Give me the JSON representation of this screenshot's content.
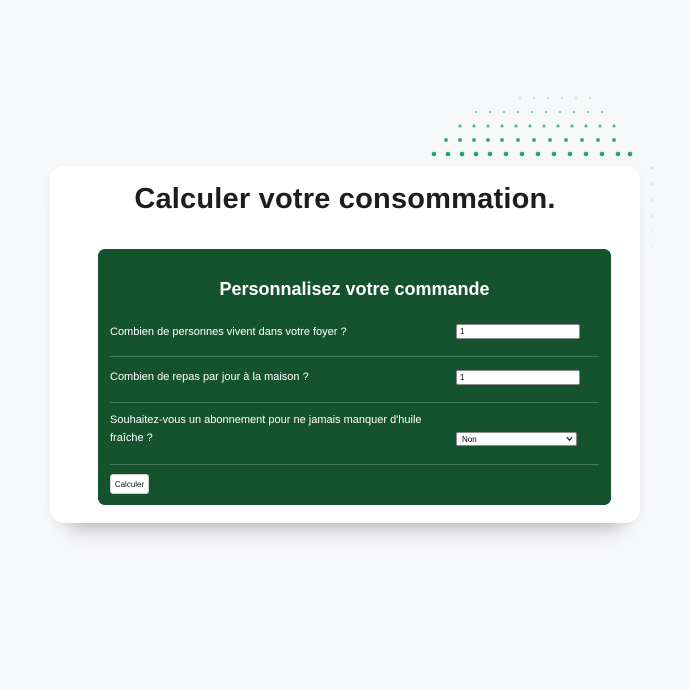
{
  "title": "Calculer votre consommation.",
  "form": {
    "heading": "Personnalisez votre commande",
    "q1_label": "Combien de personnes vivent dans votre foyer ?",
    "q1_value": "1",
    "q2_label": "Combien de repas par jour à la maison ?",
    "q2_value": "1",
    "q3_label": "Souhaitez-vous un abonnement pour ne jamais manquer d'huile fraîche ?",
    "q3_selected": "Non",
    "submit_label": "Calculer"
  },
  "colors": {
    "panel": "#14532d",
    "dots": "#22a55a",
    "background": "#f7f8fa"
  }
}
